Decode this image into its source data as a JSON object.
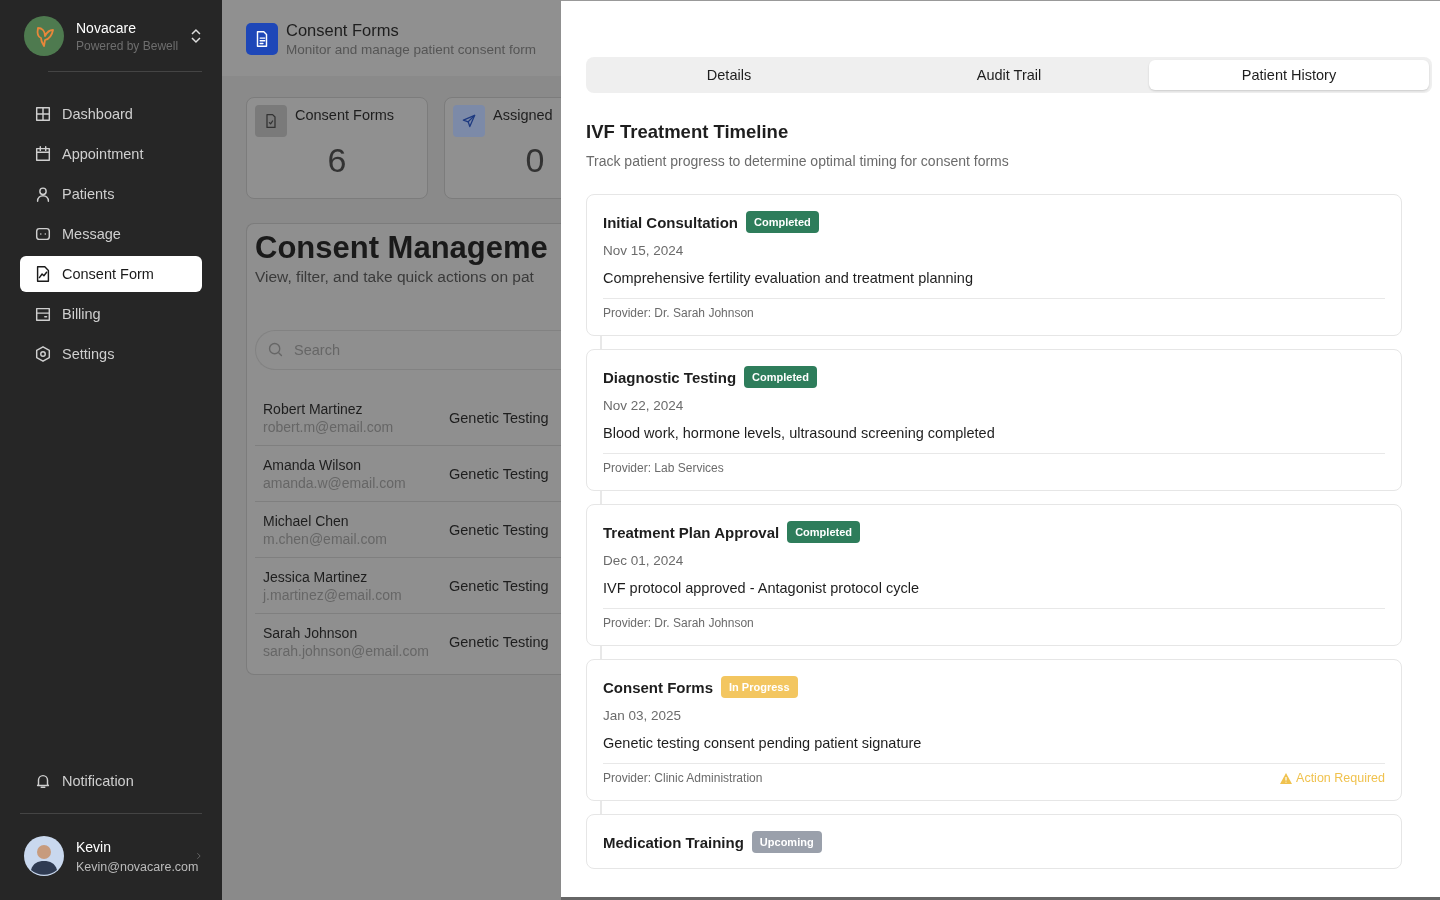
{
  "sidebar": {
    "brand": {
      "name": "Novacare",
      "subtitle": "Powered by Bewell"
    },
    "items": [
      {
        "label": "Dashboard",
        "selected": false
      },
      {
        "label": "Appointment",
        "selected": false
      },
      {
        "label": "Patients",
        "selected": false
      },
      {
        "label": "Message",
        "selected": false
      },
      {
        "label": "Consent Form",
        "selected": true
      },
      {
        "label": "Billing",
        "selected": false
      },
      {
        "label": "Settings",
        "selected": false
      }
    ],
    "notification": {
      "label": "Notification"
    },
    "user": {
      "name": "Kevin",
      "email": "Kevin@novacare.com"
    }
  },
  "page": {
    "title": "Consent Forms",
    "subtitle": "Monitor and manage patient consent form",
    "stats": [
      {
        "label": "Consent Forms",
        "value": "6"
      },
      {
        "label": "Assigned",
        "value": "0"
      }
    ],
    "panel": {
      "title": "Consent Manageme",
      "subtitle": "View, filter, and take quick actions on pat",
      "search": {
        "placeholder": "Search"
      },
      "rows": [
        {
          "name": "Robert Martinez",
          "email": "robert.m@email.com",
          "form": "Genetic Testing"
        },
        {
          "name": "Amanda Wilson",
          "email": "amanda.w@email.com",
          "form": "Genetic Testing"
        },
        {
          "name": "Michael Chen",
          "email": "m.chen@email.com",
          "form": "Genetic Testing"
        },
        {
          "name": "Jessica Martinez",
          "email": "j.martinez@email.com",
          "form": "Genetic Testing"
        },
        {
          "name": "Sarah Johnson",
          "email": "sarah.johnson@email.com",
          "form": "Genetic Testing"
        }
      ]
    }
  },
  "drawer": {
    "tabs": [
      {
        "label": "Details",
        "selected": false
      },
      {
        "label": "Audit Trail",
        "selected": false
      },
      {
        "label": "Patient History",
        "selected": true
      }
    ],
    "title": "IVF Treatment Timeline",
    "subtitle": "Track patient progress to determine optimal timing for consent forms",
    "events": [
      {
        "title": "Initial Consultation",
        "status": "Completed",
        "kind": "completed",
        "date": "Nov 15, 2024",
        "description": "Comprehensive fertility evaluation and treatment planning",
        "provider": "Provider: Dr. Sarah Johnson"
      },
      {
        "title": "Diagnostic Testing",
        "status": "Completed",
        "kind": "completed",
        "date": "Nov 22, 2024",
        "description": "Blood work, hormone levels, ultrasound screening completed",
        "provider": "Provider: Lab Services"
      },
      {
        "title": "Treatment Plan Approval",
        "status": "Completed",
        "kind": "completed",
        "date": "Dec 01, 2024",
        "description": "IVF protocol approved - Antagonist protocol cycle",
        "provider": "Provider: Dr. Sarah Johnson"
      },
      {
        "title": "Consent Forms",
        "status": "In Progress",
        "kind": "in_progress",
        "date": "Jan 03, 2025",
        "description": "Genetic testing consent pending patient signature",
        "provider": "Provider: Clinic Administration",
        "alert": "Action Required"
      },
      {
        "title": "Medication Training",
        "status": "Upcoming",
        "kind": "upcoming"
      }
    ]
  }
}
